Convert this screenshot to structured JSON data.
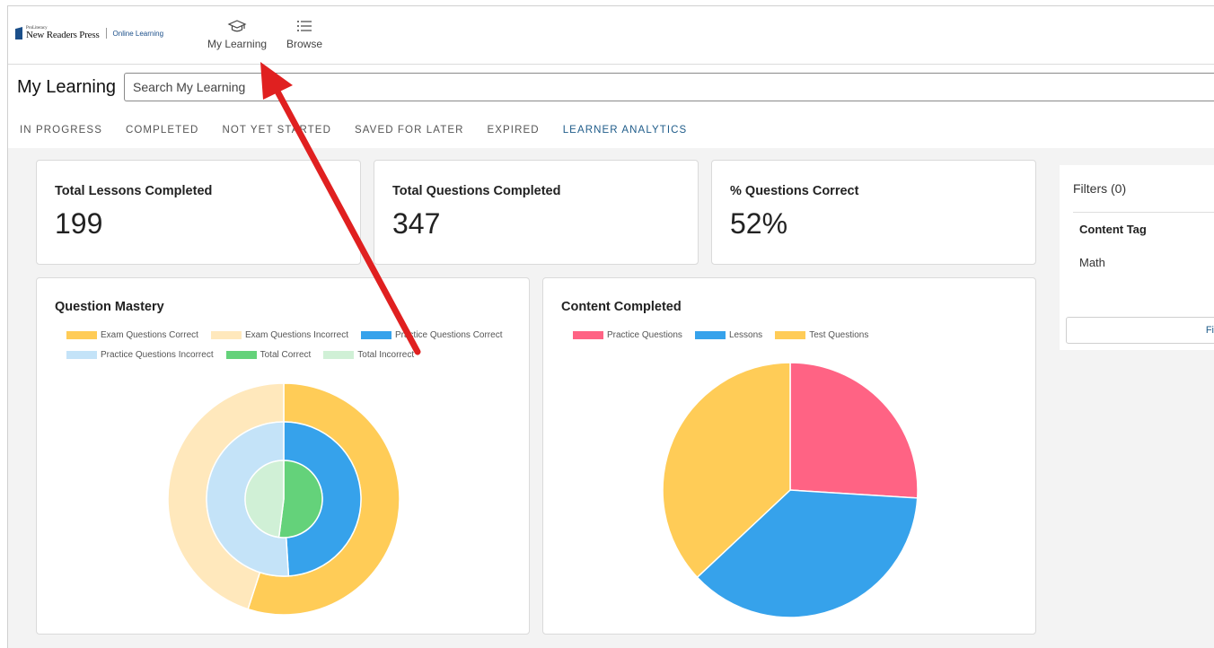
{
  "brand": {
    "small": "ProLiteracy",
    "name": "New Readers Press",
    "sub": "Online Learning"
  },
  "nav": {
    "my_learning": "My Learning",
    "browse": "Browse"
  },
  "page": {
    "title": "My Learning",
    "search_placeholder": "Search My Learning"
  },
  "tabs": [
    {
      "label": "IN PROGRESS"
    },
    {
      "label": "COMPLETED"
    },
    {
      "label": "NOT YET STARTED"
    },
    {
      "label": "SAVED FOR LATER"
    },
    {
      "label": "EXPIRED"
    },
    {
      "label": "LEARNER ANALYTICS",
      "active": true
    }
  ],
  "stats": [
    {
      "label": "Total Lessons Completed",
      "value": "199"
    },
    {
      "label": "Total Questions Completed",
      "value": "347"
    },
    {
      "label": "% Questions Correct",
      "value": "52%"
    }
  ],
  "filters": {
    "title": "Filters (0)",
    "heading": "Content Tag",
    "item": "Math",
    "button": "Fi"
  },
  "colors": {
    "exam_correct": "#ffcc57",
    "exam_incorrect": "#ffe8bc",
    "practice_correct": "#36a2eb",
    "practice_incorrect": "#c4e3f8",
    "total_correct": "#64d27a",
    "total_incorrect": "#d0f0d6",
    "pink": "#ff6384",
    "accent": "#1f5c8a",
    "annotation_arrow": "#e02020"
  },
  "chart_data": [
    {
      "type": "pie",
      "title": "Question Mastery",
      "legend": [
        "Exam Questions Correct",
        "Exam Questions Incorrect",
        "Practice Questions Correct",
        "Practice Questions Incorrect",
        "Total Correct",
        "Total Incorrect"
      ],
      "rings": [
        {
          "series": "Exam",
          "values": [
            {
              "name": "Exam Questions Correct",
              "value": 55
            },
            {
              "name": "Exam Questions Incorrect",
              "value": 45
            }
          ]
        },
        {
          "series": "Practice",
          "values": [
            {
              "name": "Practice Questions Correct",
              "value": 49
            },
            {
              "name": "Practice Questions Incorrect",
              "value": 51
            }
          ]
        },
        {
          "series": "Total",
          "values": [
            {
              "name": "Total Correct",
              "value": 52
            },
            {
              "name": "Total Incorrect",
              "value": 48
            }
          ]
        }
      ]
    },
    {
      "type": "pie",
      "title": "Content Completed",
      "legend": [
        "Practice Questions",
        "Lessons",
        "Test Questions"
      ],
      "slices": [
        {
          "name": "Practice Questions",
          "value": 26
        },
        {
          "name": "Lessons",
          "value": 37
        },
        {
          "name": "Test Questions",
          "value": 37
        }
      ]
    }
  ]
}
